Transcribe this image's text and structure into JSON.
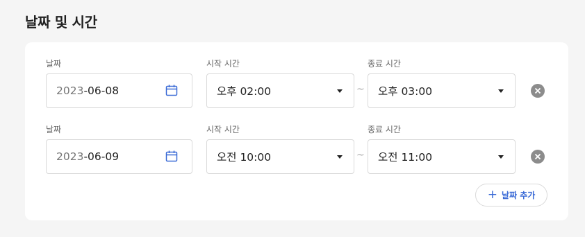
{
  "section": {
    "title": "날짜 및 시간"
  },
  "rows": [
    {
      "date_label": "날짜",
      "date_year": "2023",
      "date_rest": "-06-08",
      "start_label": "시작 시간",
      "start_value": "오후 02:00",
      "separator": "~",
      "end_label": "종료 시간",
      "end_value": "오후 03:00"
    },
    {
      "date_label": "날짜",
      "date_year": "2023",
      "date_rest": "-06-09",
      "start_label": "시작 시간",
      "start_value": "오전 10:00",
      "separator": "~",
      "end_label": "종료 시간",
      "end_value": "오전 11:00"
    }
  ],
  "add_button": {
    "icon": "plus-icon",
    "label": "날짜 추가"
  },
  "icons": {
    "calendar": "calendar-icon",
    "remove": "close-circle-icon",
    "dropdown": "caret-down-icon"
  },
  "colors": {
    "accent": "#3a6ad6",
    "remove": "#8c8c8c",
    "background": "#f5f5f5"
  }
}
